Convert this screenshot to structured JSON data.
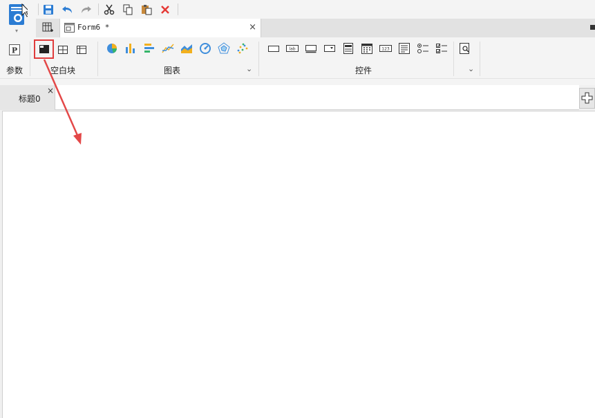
{
  "app": {
    "logo_icon": "report-designer-logo-icon",
    "logo_dropdown": "▾"
  },
  "quick_access": {
    "buttons": [
      {
        "name": "save-button",
        "icon": "save-icon"
      },
      {
        "name": "undo-button",
        "icon": "undo-icon"
      },
      {
        "name": "redo-button",
        "icon": "redo-icon"
      },
      {
        "name": "cut-button",
        "icon": "cut-icon"
      },
      {
        "name": "copy-button",
        "icon": "copy-icon"
      },
      {
        "name": "paste-button",
        "icon": "paste-icon"
      },
      {
        "name": "delete-button",
        "icon": "delete-icon"
      }
    ]
  },
  "document_tab": {
    "title": "Form6 *",
    "close": "×"
  },
  "ribbon": {
    "groups": {
      "params": {
        "label": "参数"
      },
      "blank_block": {
        "label": "空白块"
      },
      "charts": {
        "label": "图表"
      },
      "widgets": {
        "label": "控件"
      }
    },
    "chevron": "⌄"
  },
  "canvas": {
    "title_tab": {
      "label": "标题0",
      "close": "×"
    },
    "add_tab_icon": "plus-icon"
  },
  "colors": {
    "accent_blue": "#2b7cd3",
    "highlight_red": "#e03c3c",
    "delete_red": "#e53935"
  }
}
